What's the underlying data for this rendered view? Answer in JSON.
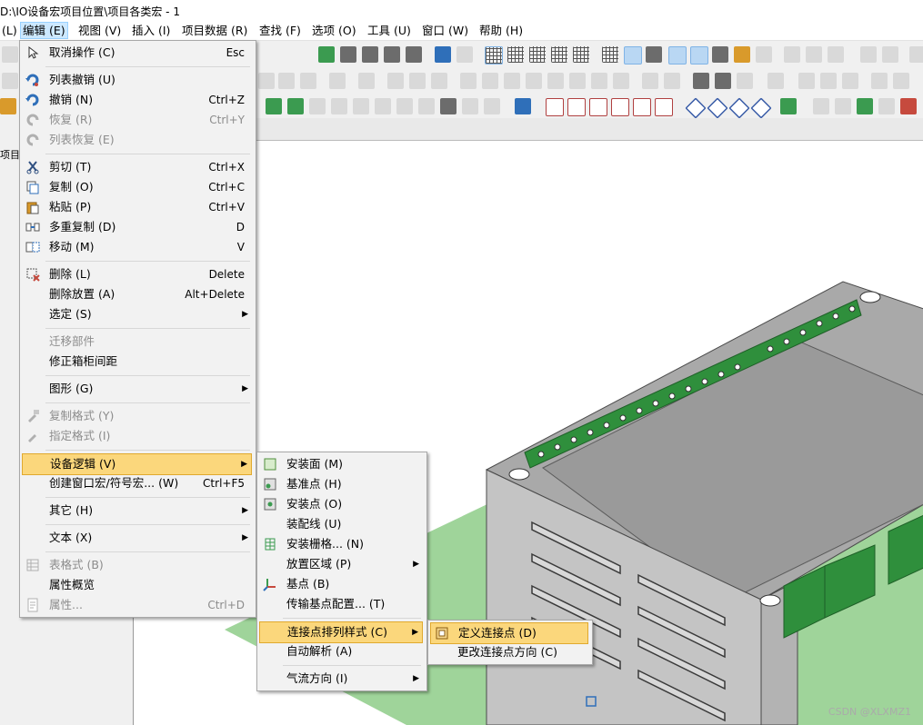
{
  "window_title": "D:\\IO设备宏项目位置\\项目各类宏 - 1",
  "menubar": [
    {
      "label": "(L)"
    },
    {
      "label": "编辑 (E)"
    },
    {
      "label": "视图 (V)"
    },
    {
      "label": "插入 (I)"
    },
    {
      "label": "项目数据 (R)"
    },
    {
      "label": "查找 (F)"
    },
    {
      "label": "选项 (O)"
    },
    {
      "label": "工具 (U)"
    },
    {
      "label": "窗口 (W)"
    },
    {
      "label": "帮助 (H)"
    }
  ],
  "left_pane": {
    "label": "项目"
  },
  "edit_menu": [
    {
      "label": "取消操作 (C)",
      "shortcut": "Esc",
      "icon": "cursor-icon"
    },
    {
      "label": "列表撤销 (U)",
      "icon": "undo-list-icon"
    },
    {
      "label": "撤销 (N)",
      "shortcut": "Ctrl+Z",
      "icon": "undo-icon"
    },
    {
      "label": "恢复 (R)",
      "shortcut": "Ctrl+Y",
      "icon": "redo-icon",
      "disabled": true
    },
    {
      "label": "列表恢复 (E)",
      "icon": "redo-list-icon",
      "disabled": true
    },
    {
      "label": "剪切 (T)",
      "shortcut": "Ctrl+X",
      "icon": "scissors-icon"
    },
    {
      "label": "复制 (O)",
      "shortcut": "Ctrl+C",
      "icon": "copy-icon"
    },
    {
      "label": "粘贴 (P)",
      "shortcut": "Ctrl+V",
      "icon": "paste-icon"
    },
    {
      "label": "多重复制 (D)",
      "shortcut": "D",
      "icon": "multi-copy-icon"
    },
    {
      "label": "移动 (M)",
      "shortcut": "V",
      "icon": "move-icon"
    },
    {
      "label": "删除 (L)",
      "shortcut": "Delete",
      "icon": "delete-icon"
    },
    {
      "label": "删除放置 (A)",
      "shortcut": "Alt+Delete"
    },
    {
      "label": "选定 (S)",
      "submenu": true
    },
    {
      "label": "迁移部件",
      "disabled": true
    },
    {
      "label": "修正箱柜间距"
    },
    {
      "label": "图形 (G)",
      "submenu": true
    },
    {
      "label": "复制格式 (Y)",
      "icon": "format-brush-icon",
      "disabled": true
    },
    {
      "label": "指定格式 (I)",
      "icon": "format-apply-icon",
      "disabled": true
    },
    {
      "label": "设备逻辑 (V)",
      "submenu": true,
      "highlighted": true
    },
    {
      "label": "创建窗口宏/符号宏... (W)",
      "shortcut": "Ctrl+F5"
    },
    {
      "label": "其它 (H)",
      "submenu": true
    },
    {
      "label": "文本 (X)",
      "submenu": true
    },
    {
      "label": "表格式 (B)",
      "icon": "table-icon",
      "disabled": true
    },
    {
      "label": "属性概览"
    },
    {
      "label": "属性...",
      "shortcut": "Ctrl+D",
      "icon": "properties-icon",
      "disabled": true
    }
  ],
  "device_logic_menu": [
    {
      "label": "安装面 (M)",
      "icon": "mounting-surface-icon"
    },
    {
      "label": "基准点 (H)",
      "icon": "reference-point-icon"
    },
    {
      "label": "安装点 (O)",
      "icon": "mounting-point-icon"
    },
    {
      "label": "装配线 (U)"
    },
    {
      "label": "安装栅格... (N)",
      "icon": "grid-icon"
    },
    {
      "label": "放置区域 (P)",
      "submenu": true
    },
    {
      "label": "基点 (B)",
      "icon": "axes-icon"
    },
    {
      "label": "传输基点配置... (T)"
    },
    {
      "label": "连接点排列样式 (C)",
      "submenu": true,
      "highlighted": true
    },
    {
      "label": "自动解析 (A)"
    },
    {
      "label": "气流方向 (I)",
      "submenu": true
    }
  ],
  "pattern_menu": [
    {
      "label": "定义连接点 (D)",
      "icon": "define-connection-icon",
      "highlighted": true
    },
    {
      "label": "更改连接点方向 (C)"
    }
  ],
  "watermark": "CSDN @XLXMZ1",
  "colors": {
    "highlight": "#fbd77c",
    "highlight_border": "#e0a92e",
    "terminal_green": "#2f8f3c",
    "housing_gray": "#a8a8a8",
    "floor_green": "#9fd49a"
  }
}
